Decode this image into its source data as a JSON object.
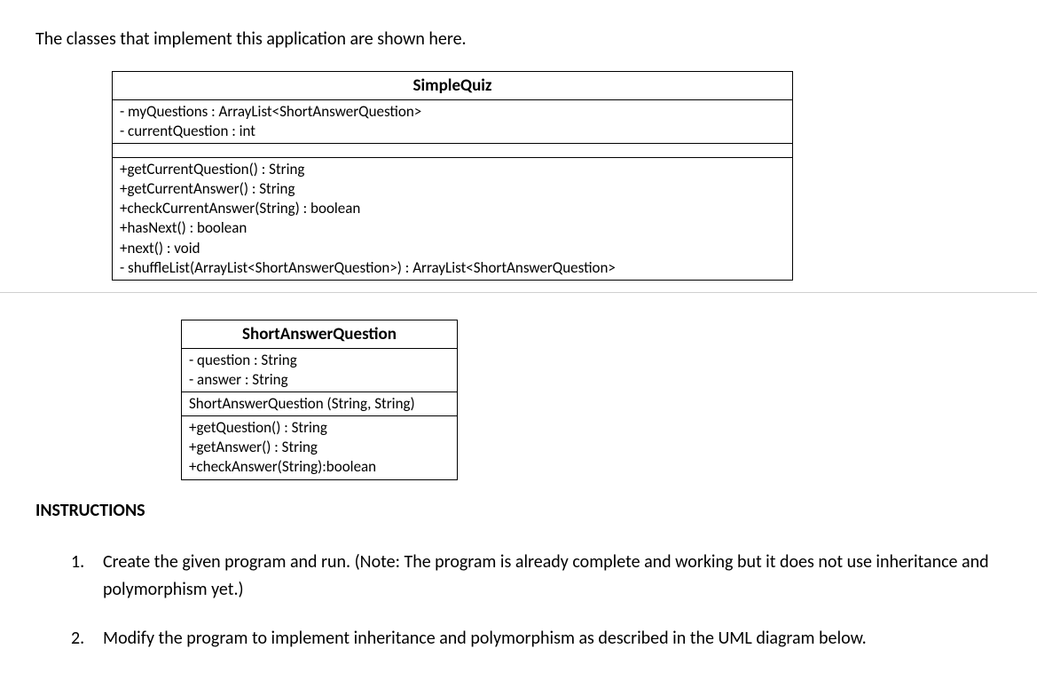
{
  "intro": "The classes that implement this application are shown here.",
  "uml1": {
    "title": "SimpleQuiz",
    "attributes": [
      "- myQuestions : ArrayList<ShortAnswerQuestion>",
      "- currentQuestion : int"
    ],
    "methods": [
      "+getCurrentQuestion() : String",
      "+getCurrentAnswer() : String",
      "+checkCurrentAnswer(String) : boolean",
      "+hasNext() : boolean",
      "+next() : void",
      "- shuffleList(ArrayList<ShortAnswerQuestion>) : ArrayList<ShortAnswerQuestion>"
    ]
  },
  "uml2": {
    "title": "ShortAnswerQuestion",
    "attributes": [
      "- question : String",
      "- answer : String"
    ],
    "constructor": "ShortAnswerQuestion (String, String)",
    "methods": [
      "+getQuestion() : String",
      "+getAnswer() : String",
      "+checkAnswer(String):boolean"
    ]
  },
  "instructionsHeading": "INSTRUCTIONS",
  "instructions": [
    {
      "num": "1.",
      "text": "Create the given program and run. (Note: The program is already complete and working but it does not use inheritance and polymorphism yet.)"
    },
    {
      "num": "2.",
      "text": "Modify the program to implement inheritance and polymorphism as described in the UML diagram below."
    }
  ]
}
